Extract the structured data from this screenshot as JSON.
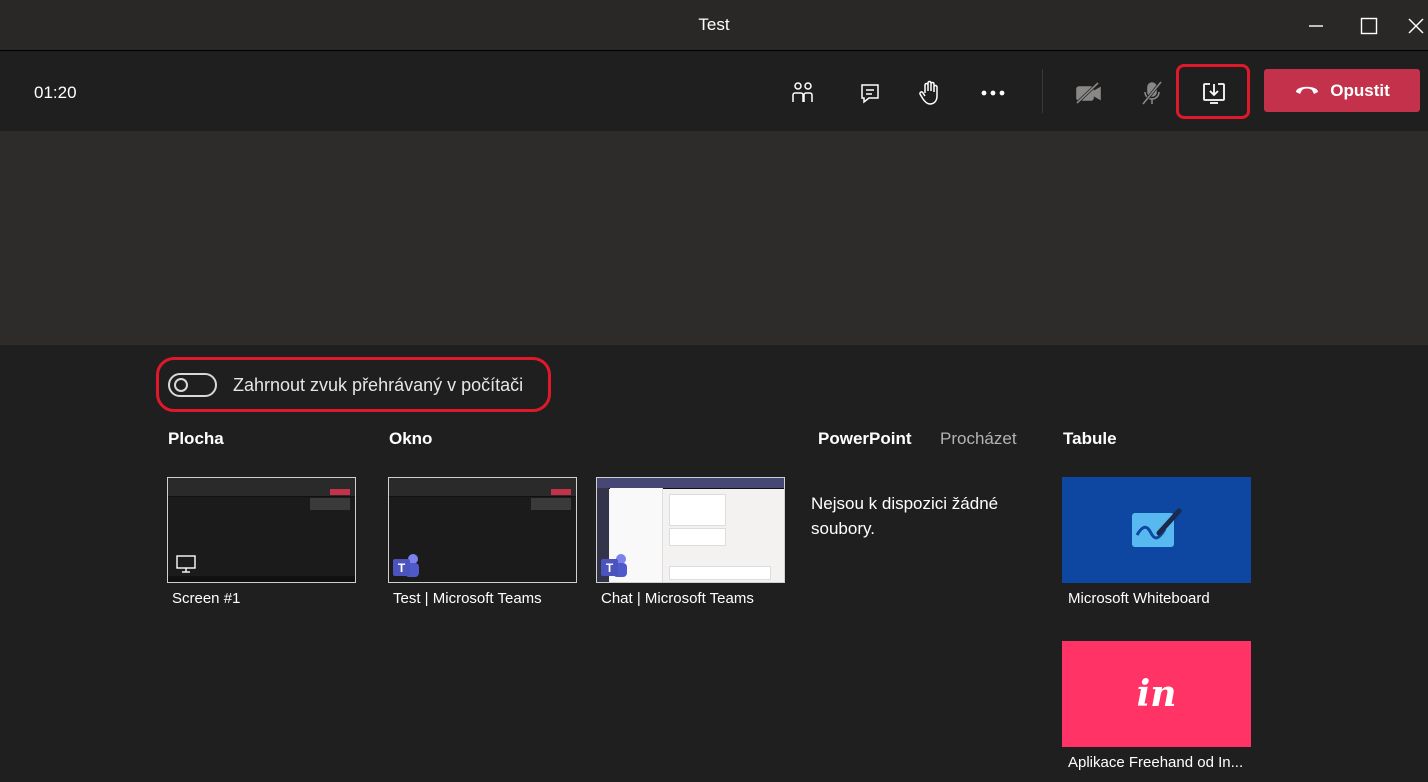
{
  "window": {
    "title": "Test",
    "controls": [
      "minimize-icon",
      "maximize-icon",
      "close-icon"
    ]
  },
  "call_toolbar": {
    "timer": "01:20",
    "icons": [
      "participants-icon",
      "chat-icon",
      "raise-hand-icon",
      "more-options-icon",
      "camera-off-icon",
      "mic-off-icon",
      "share-tray-icon"
    ],
    "leave_label": "Opustit",
    "leave_color": "#c4314b"
  },
  "share_tray": {
    "include_audio_label": "Zahrnout zvuk přehrávaný v počítači",
    "include_audio_on": false,
    "sections": {
      "desktop": "Plocha",
      "window": "Okno",
      "powerpoint": "PowerPoint",
      "browse": "Procházet",
      "whiteboard": "Tabule"
    },
    "desktop_items": [
      {
        "label": "Screen #1"
      }
    ],
    "window_items": [
      {
        "label": "Test | Microsoft Teams"
      },
      {
        "label": "Chat | Microsoft Teams"
      }
    ],
    "powerpoint_empty": "Nejsou k dispozici žádné soubory.",
    "whiteboard_apps": [
      {
        "label": "Microsoft Whiteboard",
        "color": "#0d47a1"
      },
      {
        "label": "Aplikace Freehand od In...",
        "color": "#ff3366",
        "logo_text": "in"
      }
    ]
  },
  "highlight_color": "#e0192a"
}
